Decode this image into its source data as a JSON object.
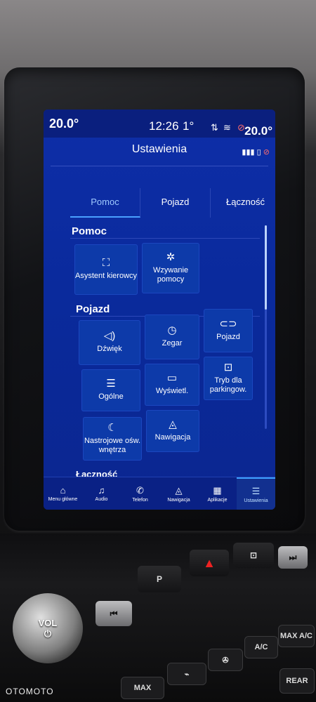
{
  "status": {
    "temp_left": "20.0°",
    "clock": "12:26",
    "outside_temp": "1°",
    "temp_right": "20.0°"
  },
  "header": {
    "title": "Ustawienia"
  },
  "tabs": [
    {
      "label": "Pomoc",
      "active": true
    },
    {
      "label": "Pojazd",
      "active": false
    },
    {
      "label": "Łączność",
      "active": false
    }
  ],
  "sections": {
    "pomoc": {
      "title": "Pomoc",
      "tiles": [
        {
          "label": "Asystent kierowcy",
          "icon": "driver-assist-icon"
        },
        {
          "label": "Wzywanie pomocy",
          "icon": "emergency-icon"
        }
      ]
    },
    "pojazd": {
      "title": "Pojazd",
      "tiles": [
        {
          "label": "Dźwięk",
          "icon": "speaker-icon"
        },
        {
          "label": "Zegar",
          "icon": "clock-icon"
        },
        {
          "label": "Pojazd",
          "icon": "car-icon"
        },
        {
          "label": "Ogólne",
          "icon": "sliders-icon"
        },
        {
          "label": "Wyświetl.",
          "icon": "display-icon"
        },
        {
          "label": "Tryb dla parkingow.",
          "icon": "parking-lock-icon"
        },
        {
          "label": "Nastrojowe ośw. wnętrza",
          "icon": "ambient-light-icon"
        },
        {
          "label": "Nawigacja",
          "icon": "navigation-icon"
        }
      ]
    },
    "next_section_peek": "Łączność"
  },
  "bottom_nav": [
    {
      "label": "Menu główne",
      "icon": "home-icon"
    },
    {
      "label": "Audio",
      "icon": "music-icon"
    },
    {
      "label": "Telefon",
      "icon": "phone-icon"
    },
    {
      "label": "Nawigacja",
      "icon": "navigation-icon"
    },
    {
      "label": "Aplikacje",
      "icon": "apps-icon"
    },
    {
      "label": "Ustawienia",
      "icon": "settings-icon",
      "active": true
    }
  ],
  "console": {
    "vol_label": "VOL",
    "max_ac": "MAX A/C",
    "ac": "A/C",
    "rear": "REAR",
    "max": "MAX"
  },
  "watermark": "OTOMOTO"
}
